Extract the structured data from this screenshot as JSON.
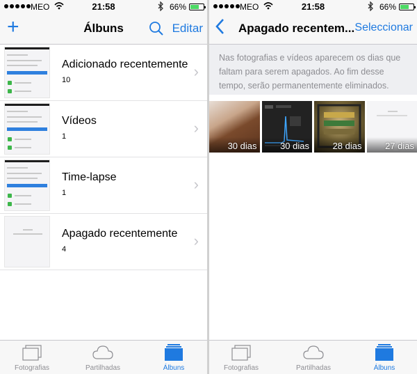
{
  "status_left": {
    "carrier": "MEO",
    "time": "21:58",
    "battery_percent_text": "66%",
    "battery_level": 0.66
  },
  "status_right": {
    "carrier": "MEO",
    "time": "21:58",
    "battery_percent_text": "66%",
    "battery_level": 0.66
  },
  "albums_screen": {
    "title": "Álbuns",
    "edit_label": "Editar",
    "albums": [
      {
        "name": "Adicionado recentemente",
        "count": "10"
      },
      {
        "name": "Vídeos",
        "count": "1"
      },
      {
        "name": "Time-lapse",
        "count": "1"
      },
      {
        "name": "Apagado recentemente",
        "count": "4"
      }
    ]
  },
  "deleted_screen": {
    "title": "Apagado recentem...",
    "select_label": "Seleccionar",
    "info_text": "Nas fotografias e vídeos aparecem os dias que faltam para serem apagados. Ao fim desse tempo, serão permanentemente eliminados.",
    "photos": [
      {
        "days": "30 dias"
      },
      {
        "days": "30 dias"
      },
      {
        "days": "28 dias"
      },
      {
        "days": "27 dias"
      }
    ]
  },
  "tabs": {
    "photos": "Fotografias",
    "shared": "Partilhadas",
    "albums": "Álbuns"
  },
  "colors": {
    "accent": "#1f7ae0",
    "inactive": "#8e8e93"
  },
  "icons": {
    "add": "plus-icon",
    "search": "search-icon",
    "back": "chevron-left-icon",
    "disclosure": "chevron-right-icon"
  }
}
